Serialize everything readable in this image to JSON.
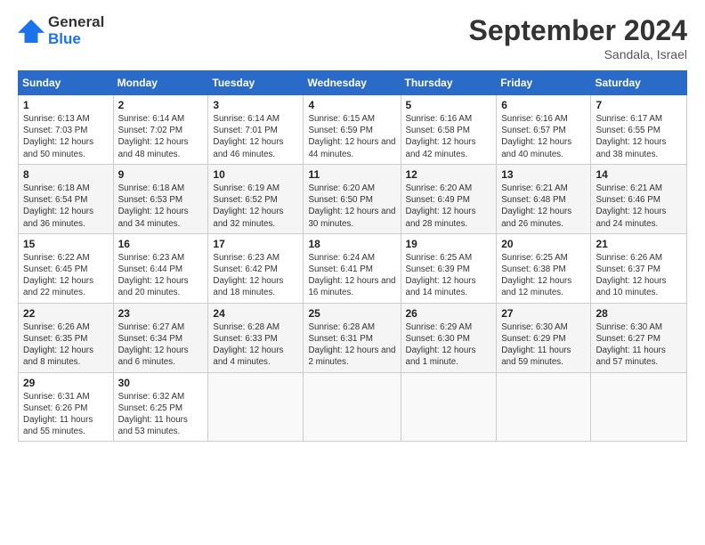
{
  "header": {
    "logo_line1": "General",
    "logo_line2": "Blue",
    "month": "September 2024",
    "location": "Sandala, Israel"
  },
  "weekdays": [
    "Sunday",
    "Monday",
    "Tuesday",
    "Wednesday",
    "Thursday",
    "Friday",
    "Saturday"
  ],
  "weeks": [
    [
      {
        "day": "1",
        "sunrise": "Sunrise: 6:13 AM",
        "sunset": "Sunset: 7:03 PM",
        "daylight": "Daylight: 12 hours and 50 minutes."
      },
      {
        "day": "2",
        "sunrise": "Sunrise: 6:14 AM",
        "sunset": "Sunset: 7:02 PM",
        "daylight": "Daylight: 12 hours and 48 minutes."
      },
      {
        "day": "3",
        "sunrise": "Sunrise: 6:14 AM",
        "sunset": "Sunset: 7:01 PM",
        "daylight": "Daylight: 12 hours and 46 minutes."
      },
      {
        "day": "4",
        "sunrise": "Sunrise: 6:15 AM",
        "sunset": "Sunset: 6:59 PM",
        "daylight": "Daylight: 12 hours and 44 minutes."
      },
      {
        "day": "5",
        "sunrise": "Sunrise: 6:16 AM",
        "sunset": "Sunset: 6:58 PM",
        "daylight": "Daylight: 12 hours and 42 minutes."
      },
      {
        "day": "6",
        "sunrise": "Sunrise: 6:16 AM",
        "sunset": "Sunset: 6:57 PM",
        "daylight": "Daylight: 12 hours and 40 minutes."
      },
      {
        "day": "7",
        "sunrise": "Sunrise: 6:17 AM",
        "sunset": "Sunset: 6:55 PM",
        "daylight": "Daylight: 12 hours and 38 minutes."
      }
    ],
    [
      {
        "day": "8",
        "sunrise": "Sunrise: 6:18 AM",
        "sunset": "Sunset: 6:54 PM",
        "daylight": "Daylight: 12 hours and 36 minutes."
      },
      {
        "day": "9",
        "sunrise": "Sunrise: 6:18 AM",
        "sunset": "Sunset: 6:53 PM",
        "daylight": "Daylight: 12 hours and 34 minutes."
      },
      {
        "day": "10",
        "sunrise": "Sunrise: 6:19 AM",
        "sunset": "Sunset: 6:52 PM",
        "daylight": "Daylight: 12 hours and 32 minutes."
      },
      {
        "day": "11",
        "sunrise": "Sunrise: 6:20 AM",
        "sunset": "Sunset: 6:50 PM",
        "daylight": "Daylight: 12 hours and 30 minutes."
      },
      {
        "day": "12",
        "sunrise": "Sunrise: 6:20 AM",
        "sunset": "Sunset: 6:49 PM",
        "daylight": "Daylight: 12 hours and 28 minutes."
      },
      {
        "day": "13",
        "sunrise": "Sunrise: 6:21 AM",
        "sunset": "Sunset: 6:48 PM",
        "daylight": "Daylight: 12 hours and 26 minutes."
      },
      {
        "day": "14",
        "sunrise": "Sunrise: 6:21 AM",
        "sunset": "Sunset: 6:46 PM",
        "daylight": "Daylight: 12 hours and 24 minutes."
      }
    ],
    [
      {
        "day": "15",
        "sunrise": "Sunrise: 6:22 AM",
        "sunset": "Sunset: 6:45 PM",
        "daylight": "Daylight: 12 hours and 22 minutes."
      },
      {
        "day": "16",
        "sunrise": "Sunrise: 6:23 AM",
        "sunset": "Sunset: 6:44 PM",
        "daylight": "Daylight: 12 hours and 20 minutes."
      },
      {
        "day": "17",
        "sunrise": "Sunrise: 6:23 AM",
        "sunset": "Sunset: 6:42 PM",
        "daylight": "Daylight: 12 hours and 18 minutes."
      },
      {
        "day": "18",
        "sunrise": "Sunrise: 6:24 AM",
        "sunset": "Sunset: 6:41 PM",
        "daylight": "Daylight: 12 hours and 16 minutes."
      },
      {
        "day": "19",
        "sunrise": "Sunrise: 6:25 AM",
        "sunset": "Sunset: 6:39 PM",
        "daylight": "Daylight: 12 hours and 14 minutes."
      },
      {
        "day": "20",
        "sunrise": "Sunrise: 6:25 AM",
        "sunset": "Sunset: 6:38 PM",
        "daylight": "Daylight: 12 hours and 12 minutes."
      },
      {
        "day": "21",
        "sunrise": "Sunrise: 6:26 AM",
        "sunset": "Sunset: 6:37 PM",
        "daylight": "Daylight: 12 hours and 10 minutes."
      }
    ],
    [
      {
        "day": "22",
        "sunrise": "Sunrise: 6:26 AM",
        "sunset": "Sunset: 6:35 PM",
        "daylight": "Daylight: 12 hours and 8 minutes."
      },
      {
        "day": "23",
        "sunrise": "Sunrise: 6:27 AM",
        "sunset": "Sunset: 6:34 PM",
        "daylight": "Daylight: 12 hours and 6 minutes."
      },
      {
        "day": "24",
        "sunrise": "Sunrise: 6:28 AM",
        "sunset": "Sunset: 6:33 PM",
        "daylight": "Daylight: 12 hours and 4 minutes."
      },
      {
        "day": "25",
        "sunrise": "Sunrise: 6:28 AM",
        "sunset": "Sunset: 6:31 PM",
        "daylight": "Daylight: 12 hours and 2 minutes."
      },
      {
        "day": "26",
        "sunrise": "Sunrise: 6:29 AM",
        "sunset": "Sunset: 6:30 PM",
        "daylight": "Daylight: 12 hours and 1 minute."
      },
      {
        "day": "27",
        "sunrise": "Sunrise: 6:30 AM",
        "sunset": "Sunset: 6:29 PM",
        "daylight": "Daylight: 11 hours and 59 minutes."
      },
      {
        "day": "28",
        "sunrise": "Sunrise: 6:30 AM",
        "sunset": "Sunset: 6:27 PM",
        "daylight": "Daylight: 11 hours and 57 minutes."
      }
    ],
    [
      {
        "day": "29",
        "sunrise": "Sunrise: 6:31 AM",
        "sunset": "Sunset: 6:26 PM",
        "daylight": "Daylight: 11 hours and 55 minutes."
      },
      {
        "day": "30",
        "sunrise": "Sunrise: 6:32 AM",
        "sunset": "Sunset: 6:25 PM",
        "daylight": "Daylight: 11 hours and 53 minutes."
      },
      null,
      null,
      null,
      null,
      null
    ]
  ]
}
